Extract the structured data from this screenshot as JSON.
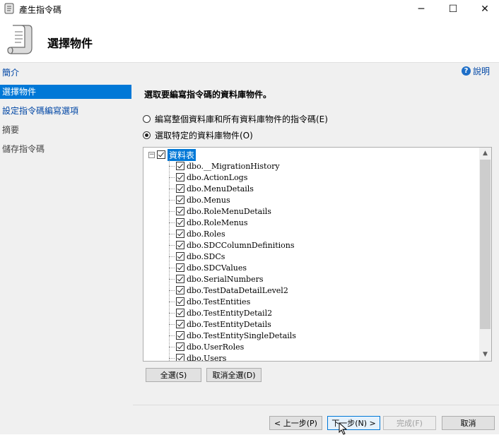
{
  "window": {
    "title": "產生指令碼",
    "minimize_glyph": "─",
    "maximize_glyph": "☐",
    "close_glyph": "✕"
  },
  "header": {
    "title": "選擇物件",
    "icon": "script-scroll-icon"
  },
  "sidebar": {
    "items": [
      {
        "label": "簡介",
        "state": "link"
      },
      {
        "label": "選擇物件",
        "state": "selected"
      },
      {
        "label": "設定指令碼編寫選項",
        "state": "link"
      },
      {
        "label": "摘要",
        "state": "disabled"
      },
      {
        "label": "儲存指令碼",
        "state": "disabled"
      }
    ]
  },
  "main": {
    "help_label": "說明",
    "heading": "選取要編寫指令碼的資料庫物件。",
    "options": [
      {
        "label": "編寫整個資料庫和所有資料庫物件的指令碼(E)",
        "checked": false
      },
      {
        "label": "選取特定的資料庫物件(O)",
        "checked": true
      }
    ],
    "tree": {
      "root_label": "資料表",
      "expander": "−",
      "items": [
        "dbo.__MigrationHistory",
        "dbo.ActionLogs",
        "dbo.MenuDetails",
        "dbo.Menus",
        "dbo.RoleMenuDetails",
        "dbo.RoleMenus",
        "dbo.Roles",
        "dbo.SDCColumnDefinitions",
        "dbo.SDCs",
        "dbo.SDCValues",
        "dbo.SerialNumbers",
        "dbo.TestDataDetailLevel2",
        "dbo.TestEntities",
        "dbo.TestEntityDetail2",
        "dbo.TestEntityDetails",
        "dbo.TestEntitySingleDetails",
        "dbo.UserRoles",
        "dbo.Users"
      ]
    },
    "select_all_label": "全選(S)",
    "deselect_all_label": "取消全選(D)"
  },
  "footer": {
    "prev_label": "< 上一步(P)",
    "next_label": "下一步(N) >",
    "finish_label": "完成(F)",
    "cancel_label": "取消"
  }
}
